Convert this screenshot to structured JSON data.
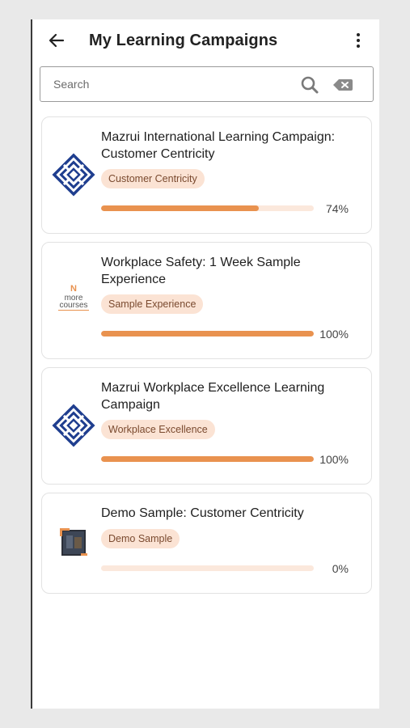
{
  "header": {
    "title": "My Learning Campaigns"
  },
  "search": {
    "placeholder": "Search"
  },
  "campaigns": [
    {
      "title": "Mazrui International Learning Campaign: Customer Centricity",
      "tag": "Customer Centricity",
      "progress_label": "74%",
      "progress": 0.74,
      "logo": "mazrui-logo"
    },
    {
      "title": "Workplace Safety: 1 Week Sample Experience",
      "tag": "Sample Experience",
      "progress_label": "100%",
      "progress": 1.0,
      "logo": "more-courses-logo",
      "logo_text": [
        "N",
        "more",
        "courses"
      ]
    },
    {
      "title": "Mazrui Workplace Excellence Learning Campaign",
      "tag": "Workplace Excellence",
      "progress_label": "100%",
      "progress": 1.0,
      "logo": "mazrui-logo"
    },
    {
      "title": "Demo Sample: Customer Centricity",
      "tag": "Demo Sample",
      "progress_label": "0%",
      "progress": 0.0,
      "logo": "demo-thumbnail"
    }
  ],
  "colors": {
    "accent": "#e9924f",
    "track": "#fbe8dc",
    "tag_bg": "#fbe3d4",
    "logo_blue": "#1f3e8f"
  }
}
